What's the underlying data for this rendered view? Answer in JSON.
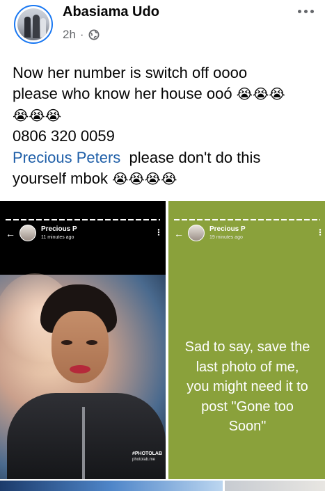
{
  "post": {
    "author_name": "Abasiama Udo",
    "timestamp": "2h",
    "separator": "·",
    "privacy_icon": "globe-icon",
    "more_icon": "more-horizontal-icon",
    "text": {
      "line1": "Now her number is switch off oooo",
      "line2_text": "please who know her house ooó ",
      "line2_emoji": "😭😭😭",
      "line3_emoji": "😭😭😭",
      "line4": "0806 320 0059",
      "mention": "Precious Peters",
      "line5_rest": "  please don't do this",
      "line6_text": "yourself mbok ",
      "line6_emoji": "😭😭😭😭"
    }
  },
  "photos": {
    "left_story": {
      "name": "Precious P",
      "time": "11 minutes ago",
      "watermark_brand": "#PHOTOLAB",
      "watermark_url": "photolab.me"
    },
    "right_story": {
      "name": "Precious P",
      "time": "19 minutes ago",
      "lines": [
        "Sad to say, save the",
        "last photo of me,",
        "you might need it to",
        "post \"Gone too",
        "Soon\""
      ],
      "background": "#8aa13b"
    }
  },
  "colors": {
    "mention": "#1f5fa8",
    "meta": "#65676b",
    "text": "#050505"
  }
}
